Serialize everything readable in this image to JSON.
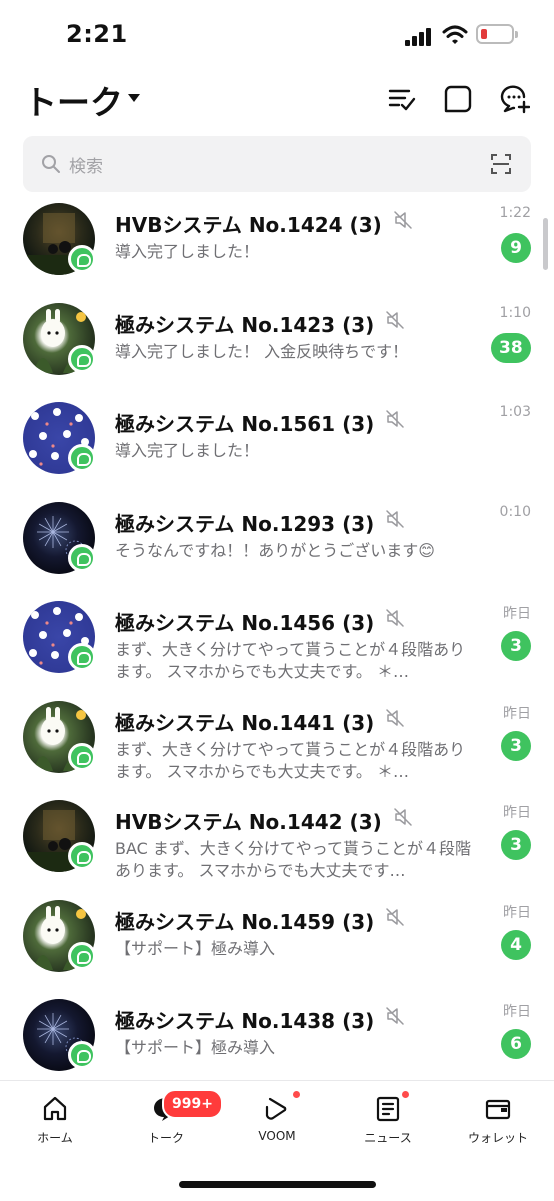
{
  "status_bar": {
    "time": "2:21"
  },
  "header": {
    "title": "トーク"
  },
  "search": {
    "placeholder": "検索"
  },
  "chats": [
    {
      "name": "HVBシステム No.1424",
      "count": "(3)",
      "preview": "導入完了しました！",
      "time": "1:22",
      "unread": "9",
      "avatar": "dark-forest"
    },
    {
      "name": "極みシステム No.1423",
      "count": "(3)",
      "preview": "導入完了しました！ 入金反映待ちです！",
      "time": "1:10",
      "unread": "38",
      "avatar": "bunny-scene"
    },
    {
      "name": "極みシステム No.1561",
      "count": "(3)",
      "preview": "導入完了しました！",
      "time": "1:03",
      "unread": "",
      "avatar": "bunny-pattern"
    },
    {
      "name": "極みシステム No.1293",
      "count": "(3)",
      "preview": "そうなんですね！！ありがとうございます😊",
      "time": "0:10",
      "unread": "",
      "avatar": "fireworks"
    },
    {
      "name": "極みシステム No.1456",
      "count": "(3)",
      "preview": " まず、大きく分けてやって貰うことが４段階あります。 スマホからでも大丈夫です。 ＊…",
      "time": "昨日",
      "unread": "3",
      "avatar": "bunny-pattern"
    },
    {
      "name": "極みシステム No.1441",
      "count": "(3)",
      "preview": " まず、大きく分けてやって貰うことが４段階あります。 スマホからでも大丈夫です。 ＊…",
      "time": "昨日",
      "unread": "3",
      "avatar": "bunny-scene"
    },
    {
      "name": "HVBシステム No.1442",
      "count": "(3)",
      "preview": " BAC まず、大きく分けてやって貰うことが４段階あります。 スマホからでも大丈夫です…",
      "time": "昨日",
      "unread": "3",
      "avatar": "dark-forest"
    },
    {
      "name": "極みシステム No.1459",
      "count": "(3)",
      "preview": "【サポート】極み導入",
      "time": "昨日",
      "unread": "4",
      "avatar": "bunny-scene"
    },
    {
      "name": "極みシステム No.1438",
      "count": "(3)",
      "preview": "【サポート】極み導入",
      "time": "昨日",
      "unread": "6",
      "avatar": "fireworks"
    }
  ],
  "tabs": [
    {
      "label": "ホーム",
      "icon": "home-icon"
    },
    {
      "label": "トーク",
      "icon": "chat-icon",
      "badge": "999+"
    },
    {
      "label": "VOOM",
      "icon": "voom-icon"
    },
    {
      "label": "ニュース",
      "icon": "news-icon"
    },
    {
      "label": "ウォレット",
      "icon": "wallet-icon"
    }
  ],
  "colors": {
    "accent": "#3fc35f",
    "badge_red": "#ff3b3b",
    "text": "#111111",
    "muted": "#6f6f73"
  }
}
